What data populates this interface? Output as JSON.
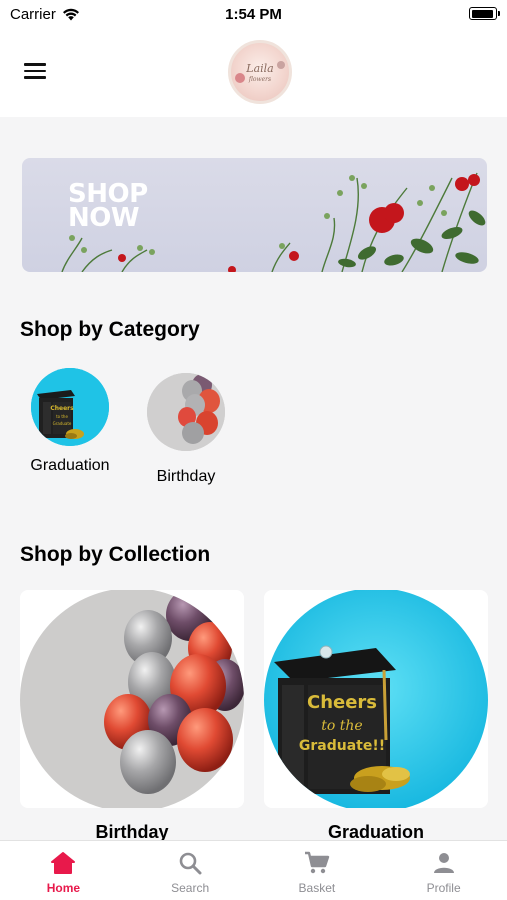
{
  "status_bar": {
    "carrier": "Carrier",
    "time": "1:54 PM"
  },
  "header": {
    "logo_text": "Laila",
    "logo_subtext": "flowers"
  },
  "banner": {
    "line1": "SHOP",
    "line2": "NOW"
  },
  "sections": {
    "category_title": "Shop by Category",
    "collection_title": "Shop by Collection"
  },
  "categories": [
    {
      "label": "Graduation"
    },
    {
      "label": "Birthday"
    }
  ],
  "collections": [
    {
      "title": "Birthday"
    },
    {
      "title": "Graduation"
    }
  ],
  "grad_sign": {
    "line1": "Cheers",
    "line2": "to the",
    "line3": "Graduate!!"
  },
  "tabbar": [
    {
      "label": "Home",
      "icon": "home-icon",
      "active": true
    },
    {
      "label": "Search",
      "icon": "search-icon",
      "active": false
    },
    {
      "label": "Basket",
      "icon": "cart-icon",
      "active": false
    },
    {
      "label": "Profile",
      "icon": "person-icon",
      "active": false
    }
  ],
  "colors": {
    "accent": "#e8194b",
    "inactive": "#8e8e93",
    "background": "#f5f5f6"
  }
}
